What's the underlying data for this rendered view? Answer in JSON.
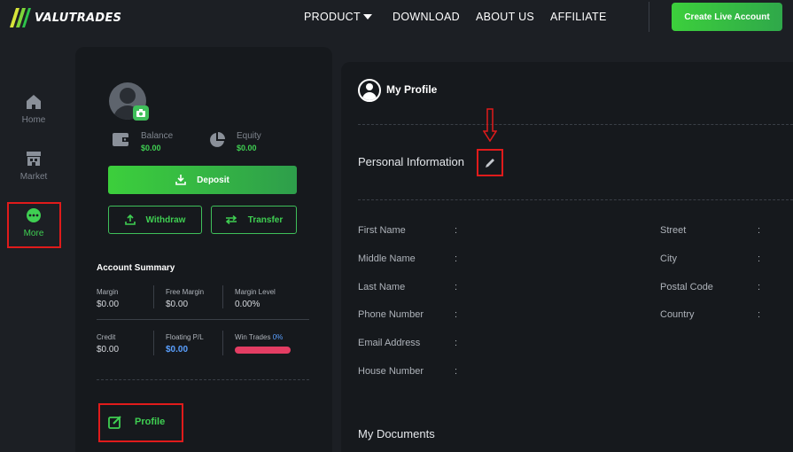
{
  "brand": {
    "name": "VALUTRADES",
    "colors": {
      "accent": "#3fcf52",
      "highlight": "#e01b1b",
      "loss": "#e33d63",
      "link": "#5aa0ff"
    }
  },
  "nav": {
    "product": "PRODUCT",
    "download": "DOWNLOAD",
    "about": "ABOUT US",
    "affiliate": "AFFILIATE",
    "cta": "Create Live Account"
  },
  "rail": {
    "home": {
      "label": "Home",
      "icon": "home-icon"
    },
    "market": {
      "label": "Market",
      "icon": "store-icon"
    },
    "more": {
      "label": "More",
      "icon": "more-dots-icon"
    }
  },
  "account": {
    "balance_label": "Balance",
    "balance_value": "$0.00",
    "equity_label": "Equity",
    "equity_value": "$0.00",
    "deposit": "Deposit",
    "withdraw": "Withdraw",
    "transfer": "Transfer",
    "summary_title": "Account Summary",
    "margin_label": "Margin",
    "margin_value": "$0.00",
    "free_margin_label": "Free Margin",
    "free_margin_value": "$0.00",
    "margin_level_label": "Margin Level",
    "margin_level_value": "0.00%",
    "credit_label": "Credit",
    "credit_value": "$0.00",
    "floating_label": "Floating P/L",
    "floating_value": "$0.00",
    "win_label": "Win Trades",
    "win_value": "0%",
    "profile_link": "Profile"
  },
  "profile": {
    "title": "My Profile",
    "personal_info": "Personal Information",
    "documents": "My Documents",
    "colon": ":",
    "left_fields": [
      "First Name",
      "Middle Name",
      "Last Name",
      "Phone Number",
      "Email Address",
      "House Number"
    ],
    "right_fields": [
      "Street",
      "City",
      "Postal Code",
      "Country"
    ]
  }
}
